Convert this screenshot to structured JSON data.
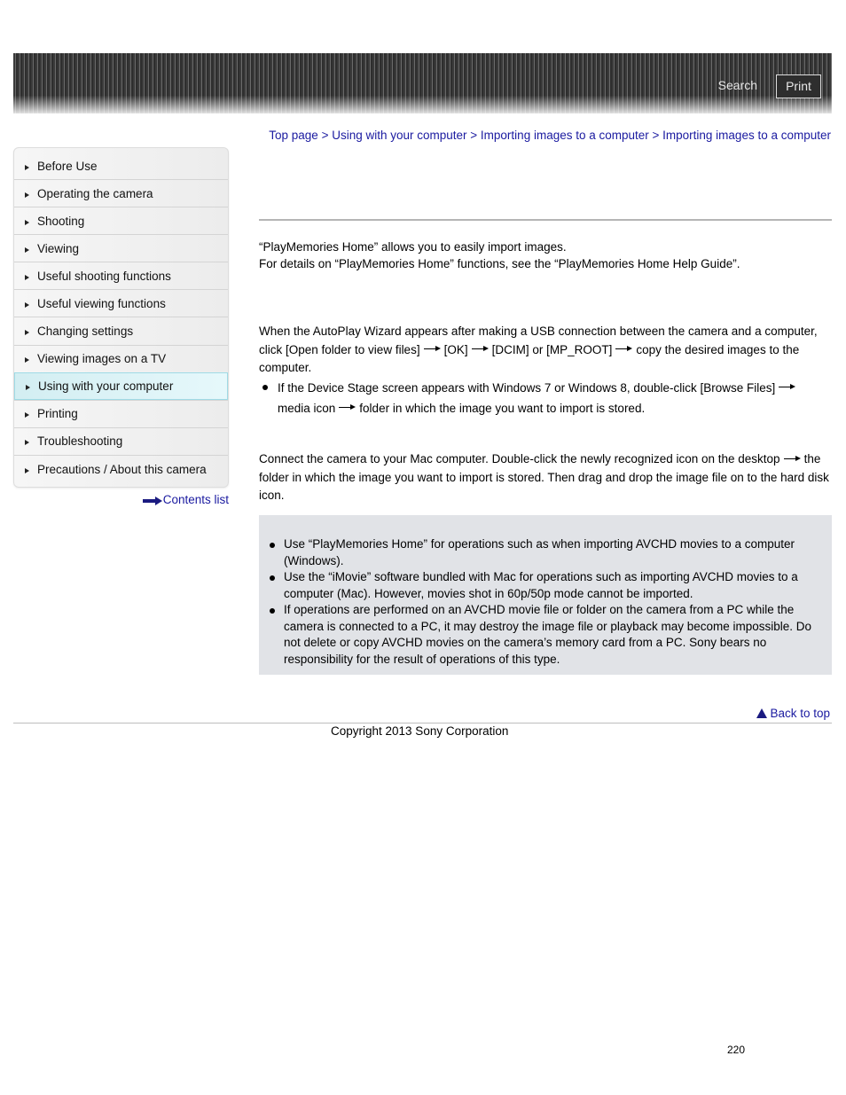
{
  "header": {
    "search_label": "Search",
    "print_label": "Print"
  },
  "sidebar": {
    "items": [
      {
        "label": "Before Use",
        "active": false
      },
      {
        "label": "Operating the camera",
        "active": false
      },
      {
        "label": "Shooting",
        "active": false
      },
      {
        "label": "Viewing",
        "active": false
      },
      {
        "label": "Useful shooting functions",
        "active": false
      },
      {
        "label": "Useful viewing functions",
        "active": false
      },
      {
        "label": "Changing settings",
        "active": false
      },
      {
        "label": "Viewing images on a TV",
        "active": false
      },
      {
        "label": "Using with your computer",
        "active": true
      },
      {
        "label": "Printing",
        "active": false
      },
      {
        "label": "Troubleshooting",
        "active": false
      },
      {
        "label": "Precautions / About this camera",
        "active": false
      }
    ],
    "contents_list_label": "Contents list"
  },
  "breadcrumb": {
    "items": [
      "Top page",
      "Using with your computer",
      "Importing images to a computer",
      "Importing images to a computer"
    ],
    "separator": " > "
  },
  "intro": {
    "line1": "“PlayMemories Home” allows you to easily import images.",
    "line2": "For details on “PlayMemories Home” functions, see the “PlayMemories Home Help Guide”."
  },
  "windows": {
    "p1": "When the AutoPlay Wizard appears after making a USB connection between the camera and a computer, click [Open folder to view files]",
    "p2": "[OK]",
    "p3": "[DCIM] or [MP_ROOT]",
    "p4": "copy the desired images to the computer.",
    "bullet_a": "If the Device Stage screen appears with Windows 7 or Windows 8, double-click [Browse Files]",
    "bullet_b": "media icon",
    "bullet_c": "folder in which the image you want to import is stored."
  },
  "mac": {
    "p1": "Connect the camera to your Mac computer. Double-click the newly recognized icon on the desktop",
    "p2": "the folder in which the image you want to import is stored. Then drag and drop the image file on to the hard disk icon."
  },
  "notes": [
    "Use “PlayMemories Home” for operations such as when importing AVCHD movies to a computer (Windows).",
    "Use the “iMovie” software bundled with Mac for operations such as importing AVCHD movies to a computer (Mac). However, movies shot in 60p/50p mode cannot be imported.",
    "If operations are performed on an AVCHD movie file or folder on the camera from a PC while the camera is connected to a PC, it may destroy the image file or playback may become impossible. Do not delete or copy AVCHD movies on the camera’s memory card from a PC. Sony bears no responsibility for the result of operations of this type."
  ],
  "footer": {
    "back_to_top": "Back to top",
    "copyright": "Copyright 2013 Sony Corporation",
    "page_number": "220"
  },
  "colors": {
    "link": "#1a1aa0",
    "active_nav": "#d3eef2",
    "note_bg": "#e1e3e7"
  }
}
